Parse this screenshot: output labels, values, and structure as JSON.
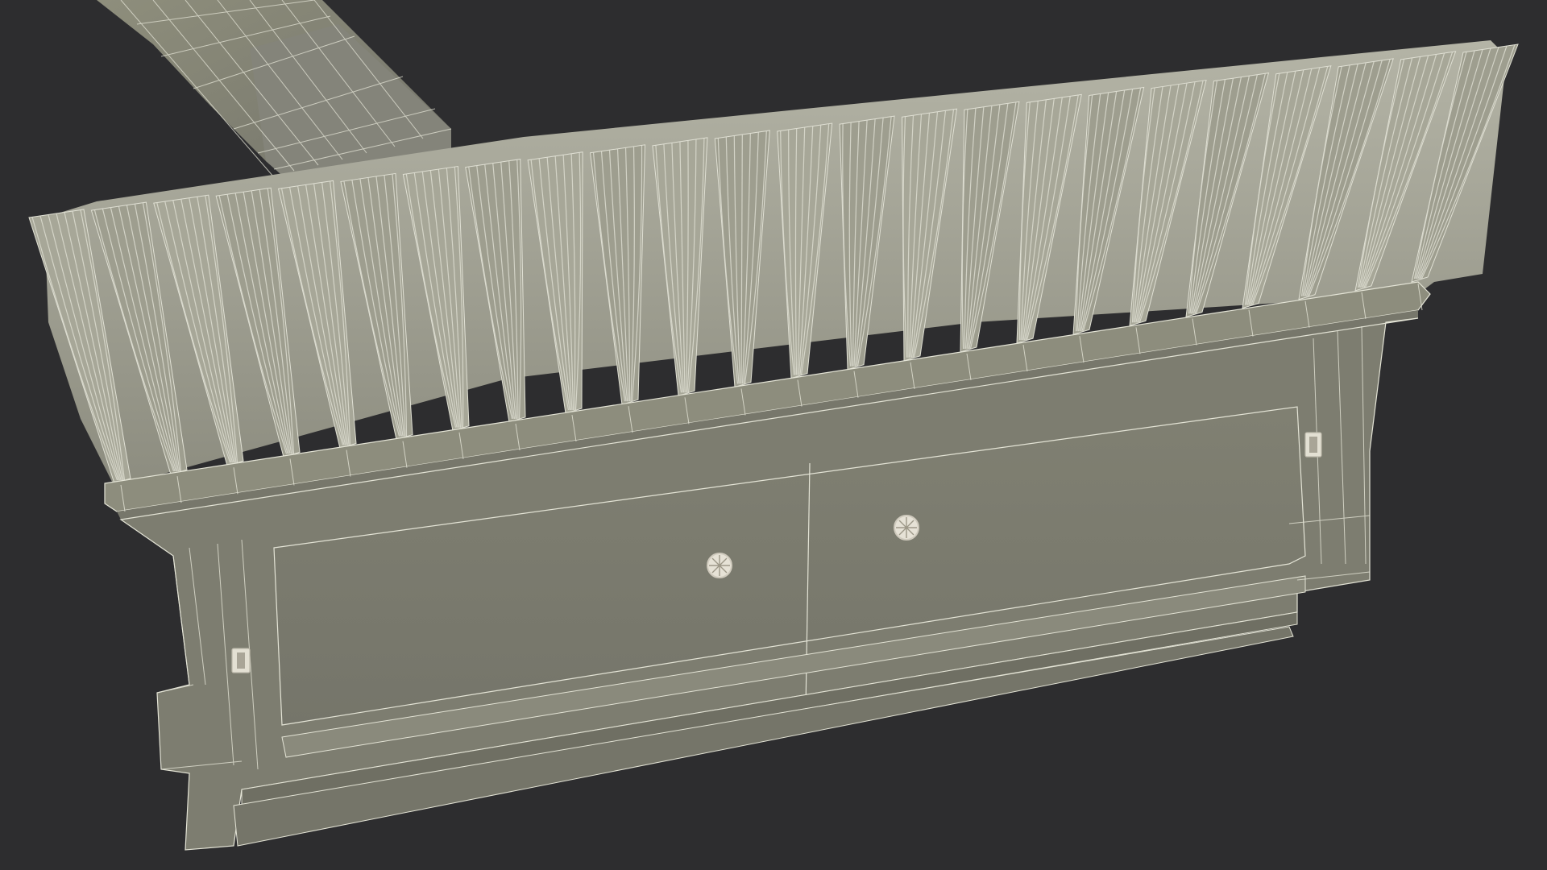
{
  "scene": {
    "subject": "broom-head-wireframe-render",
    "colors": {
      "background": "#2d2d2f",
      "surface": "#8a8a78",
      "surface_dark": "#6f6f62",
      "wire": "#e4e4d6",
      "bristle": "#a9a99a",
      "bristle_tip": "#d8d8cc"
    },
    "parts": [
      "handle",
      "bristles",
      "block",
      "screw",
      "clip"
    ]
  }
}
